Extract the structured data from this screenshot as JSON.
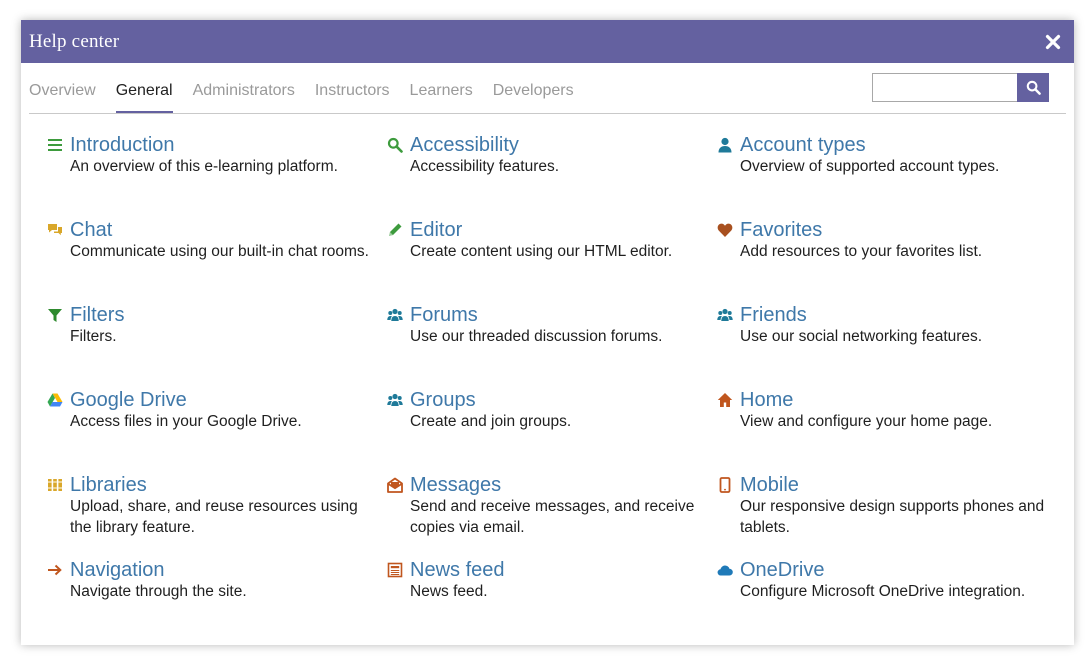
{
  "window": {
    "title": "Help center",
    "close_icon": "close-icon"
  },
  "tabs": [
    {
      "label": "Overview",
      "active": false
    },
    {
      "label": "General",
      "active": true
    },
    {
      "label": "Administrators",
      "active": false
    },
    {
      "label": "Instructors",
      "active": false
    },
    {
      "label": "Learners",
      "active": false
    },
    {
      "label": "Developers",
      "active": false
    }
  ],
  "search": {
    "value": "",
    "placeholder": "",
    "icon": "search-icon"
  },
  "colors": {
    "accent": "#6461a0",
    "link": "#3f78a9",
    "text": "#1f1f1f",
    "tab_inactive": "#9a9a9a"
  },
  "topics": [
    {
      "title": "Introduction",
      "desc": "An overview of this e-learning platform.",
      "icon": "list-icon",
      "color": "#3d9b3d"
    },
    {
      "title": "Accessibility",
      "desc": "Accessibility features.",
      "icon": "magnifier-icon",
      "color": "#3d9b3d"
    },
    {
      "title": "Account types",
      "desc": "Overview of supported account types.",
      "icon": "user-icon",
      "color": "#1f7a99"
    },
    {
      "title": "Chat",
      "desc": "Communicate using our built-in chat rooms.",
      "icon": "chat-bubbles-icon",
      "color": "#d9a72a"
    },
    {
      "title": "Editor",
      "desc": "Create content using our HTML editor.",
      "icon": "pencil-icon",
      "color": "#3d9b3d"
    },
    {
      "title": "Favorites",
      "desc": "Add resources to your favorites list.",
      "icon": "heart-icon",
      "color": "#a8501f"
    },
    {
      "title": "Filters",
      "desc": "Filters.",
      "icon": "funnel-icon",
      "color": "#2e8a2e"
    },
    {
      "title": "Forums",
      "desc": "Use our threaded discussion forums.",
      "icon": "people-icon",
      "color": "#1f7a99"
    },
    {
      "title": "Friends",
      "desc": "Use our social networking features.",
      "icon": "people-icon",
      "color": "#1f7a99"
    },
    {
      "title": "Google Drive",
      "desc": "Access files in your Google Drive.",
      "icon": "google-drive-icon",
      "color": "#4285f4"
    },
    {
      "title": "Groups",
      "desc": "Create and join groups.",
      "icon": "people-icon",
      "color": "#1f7a99"
    },
    {
      "title": "Home",
      "desc": "View and configure your home page.",
      "icon": "house-icon",
      "color": "#c0561e"
    },
    {
      "title": "Libraries",
      "desc": "Upload, share, and reuse resources using the library feature.",
      "icon": "books-icon",
      "color": "#d9a72a"
    },
    {
      "title": "Messages",
      "desc": "Send and receive messages, and receive copies via email.",
      "icon": "envelope-icon",
      "color": "#c0561e"
    },
    {
      "title": "Mobile",
      "desc": "Our responsive design supports phones and tablets.",
      "icon": "phone-icon",
      "color": "#c0561e"
    },
    {
      "title": "Navigation",
      "desc": "Navigate through the site.",
      "icon": "arrow-right-icon",
      "color": "#c0561e"
    },
    {
      "title": "News feed",
      "desc": "News feed.",
      "icon": "newspaper-icon",
      "color": "#c0561e"
    },
    {
      "title": "OneDrive",
      "desc": "Configure Microsoft OneDrive integration.",
      "icon": "cloud-icon",
      "color": "#1f7ab8"
    }
  ]
}
